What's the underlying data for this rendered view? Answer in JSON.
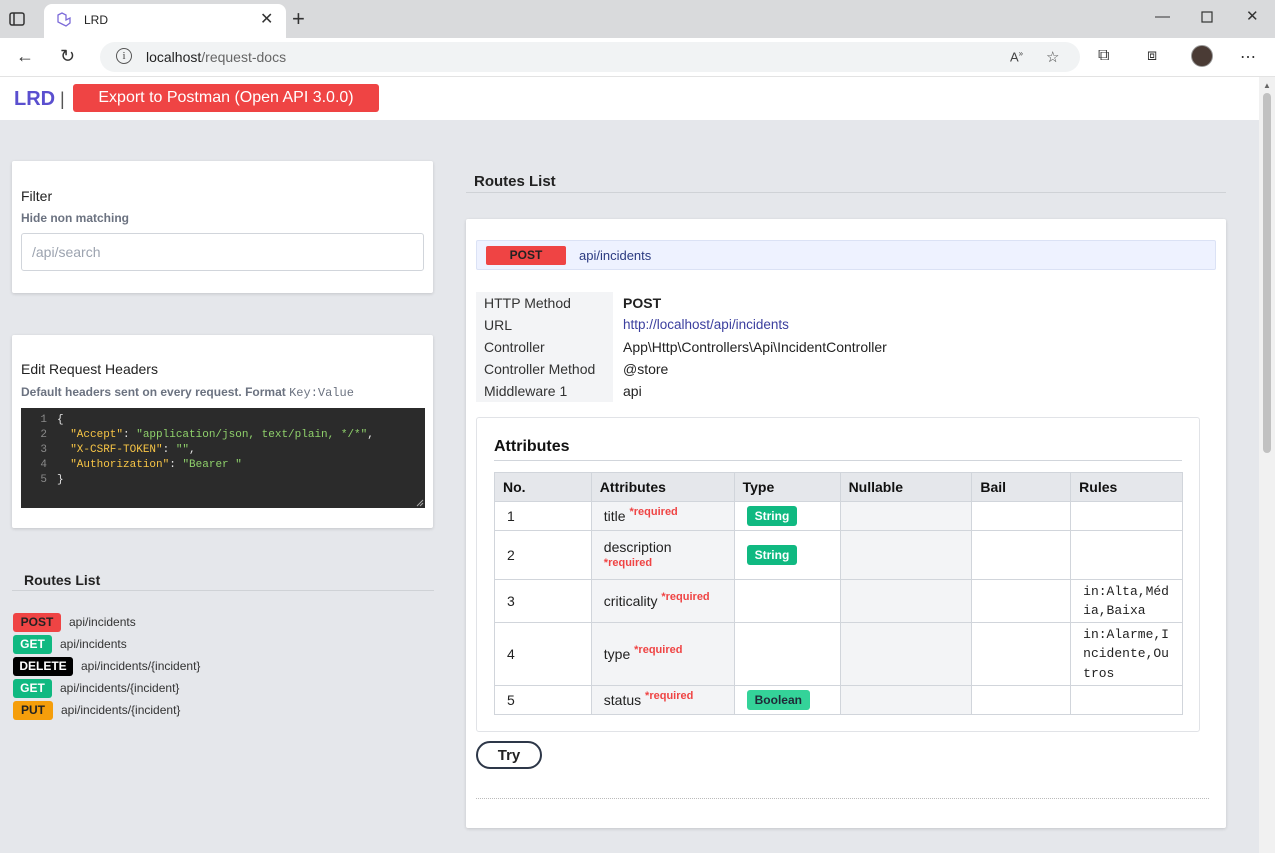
{
  "browser": {
    "tab_title": "LRD",
    "url_host": "localhost",
    "url_path": "/request-docs"
  },
  "header": {
    "brand": "LRD",
    "separator": "|",
    "export_label": "Export to Postman (Open API 3.0.0)"
  },
  "filter": {
    "title": "Filter",
    "subtitle": "Hide non matching",
    "placeholder": "/api/search"
  },
  "headers_editor": {
    "title": "Edit Request Headers",
    "subtitle": "Default headers sent on every request. Format",
    "format": "Key:Value",
    "lines": [
      {
        "num": "1",
        "text": "{"
      },
      {
        "num": "2",
        "key": "\"Accept\"",
        "value": "\"application/json, text/plain, */*\"",
        "tail": ","
      },
      {
        "num": "3",
        "key": "\"X-CSRF-TOKEN\"",
        "value": "\"\"",
        "tail": ","
      },
      {
        "num": "4",
        "key": "\"Authorization\"",
        "value": "\"Bearer \"",
        "tail": ""
      },
      {
        "num": "5",
        "text": "}"
      }
    ]
  },
  "sidebar_routes": {
    "title": "Routes List",
    "items": [
      {
        "method": "POST",
        "path": "api/incidents",
        "color": "#ef4444",
        "text_color": "#222222"
      },
      {
        "method": "GET",
        "path": "api/incidents",
        "color": "#10b981",
        "text_color": "#ffffff"
      },
      {
        "method": "DELETE",
        "path": "api/incidents/{incident}",
        "color": "#000000",
        "text_color": "#ffffff"
      },
      {
        "method": "GET",
        "path": "api/incidents/{incident}",
        "color": "#10b981",
        "text_color": "#ffffff"
      },
      {
        "method": "PUT",
        "path": "api/incidents/{incident}",
        "color": "#f59e0b",
        "text_color": "#222222"
      }
    ]
  },
  "main": {
    "title": "Routes List",
    "route": {
      "method": "POST",
      "path": "api/incidents"
    },
    "info": [
      {
        "label": "HTTP Method",
        "value": "POST"
      },
      {
        "label": "URL",
        "value": "http://localhost/api/incidents"
      },
      {
        "label": "Controller",
        "value": "App\\Http\\Controllers\\Api\\IncidentController"
      },
      {
        "label": "Controller Method",
        "value": "@store"
      },
      {
        "label": "Middleware 1",
        "value": "api"
      }
    ],
    "attributes": {
      "title": "Attributes",
      "columns": [
        "No.",
        "Attributes",
        "Type",
        "Nullable",
        "Bail",
        "Rules"
      ],
      "required_label": "*required",
      "rows": [
        {
          "no": "1",
          "name": "title",
          "type": "String",
          "rules": ""
        },
        {
          "no": "2",
          "name": "description",
          "type": "String",
          "rules": ""
        },
        {
          "no": "3",
          "name": "criticality",
          "type": "",
          "rules": "in:Alta,Média,Baixa"
        },
        {
          "no": "4",
          "name": "type",
          "type": "",
          "rules": "in:Alarme,Incidente,Outros"
        },
        {
          "no": "5",
          "name": "status",
          "type": "Boolean",
          "rules": ""
        }
      ]
    },
    "try_label": "Try"
  },
  "colors": {
    "accent": "#5a4fcf",
    "post": "#ef4444",
    "get": "#10b981",
    "put": "#f59e0b",
    "string_badge": "#10b981",
    "boolean_badge": "#34d399"
  }
}
